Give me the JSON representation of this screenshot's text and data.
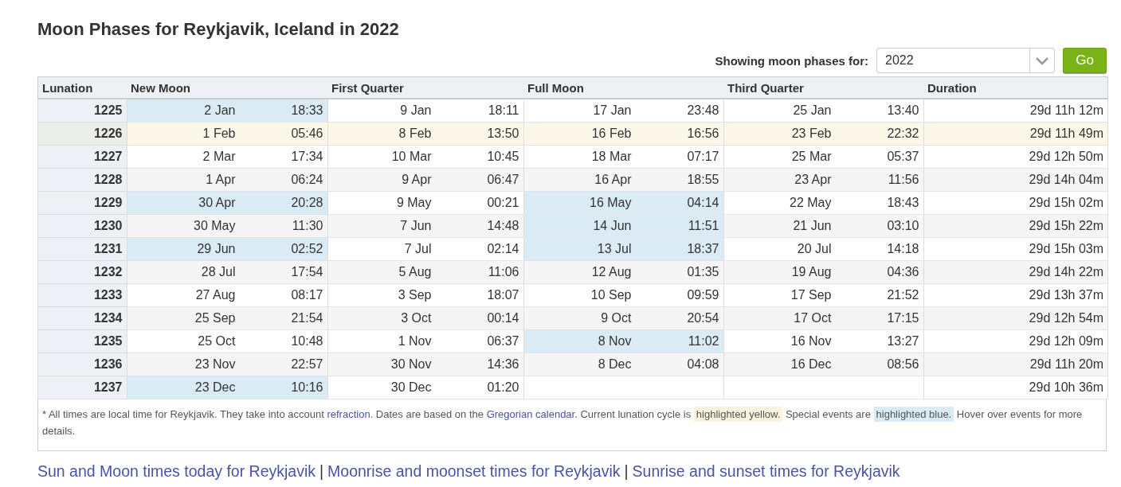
{
  "title": "Moon Phases for Reykjavik, Iceland in 2022",
  "selector": {
    "label": "Showing moon phases for:",
    "value": "2022",
    "button": "Go"
  },
  "columns": [
    "Lunation",
    "New Moon",
    "First Quarter",
    "Full Moon",
    "Third Quarter",
    "Duration"
  ],
  "rows": [
    {
      "lunation": "1225",
      "current": false,
      "phases": [
        {
          "date": "2 Jan",
          "time": "18:33",
          "special": true
        },
        {
          "date": "9 Jan",
          "time": "18:11",
          "special": false
        },
        {
          "date": "17 Jan",
          "time": "23:48",
          "special": false
        },
        {
          "date": "25 Jan",
          "time": "13:40",
          "special": false
        }
      ],
      "duration": "29d 11h 12m"
    },
    {
      "lunation": "1226",
      "current": true,
      "phases": [
        {
          "date": "1 Feb",
          "time": "05:46",
          "special": false
        },
        {
          "date": "8 Feb",
          "time": "13:50",
          "special": false
        },
        {
          "date": "16 Feb",
          "time": "16:56",
          "special": false
        },
        {
          "date": "23 Feb",
          "time": "22:32",
          "special": false
        }
      ],
      "duration": "29d 11h 49m"
    },
    {
      "lunation": "1227",
      "current": false,
      "phases": [
        {
          "date": "2 Mar",
          "time": "17:34",
          "special": false
        },
        {
          "date": "10 Mar",
          "time": "10:45",
          "special": false
        },
        {
          "date": "18 Mar",
          "time": "07:17",
          "special": false
        },
        {
          "date": "25 Mar",
          "time": "05:37",
          "special": false
        }
      ],
      "duration": "29d 12h 50m"
    },
    {
      "lunation": "1228",
      "current": false,
      "phases": [
        {
          "date": "1 Apr",
          "time": "06:24",
          "special": false
        },
        {
          "date": "9 Apr",
          "time": "06:47",
          "special": false
        },
        {
          "date": "16 Apr",
          "time": "18:55",
          "special": false
        },
        {
          "date": "23 Apr",
          "time": "11:56",
          "special": false
        }
      ],
      "duration": "29d 14h 04m"
    },
    {
      "lunation": "1229",
      "current": false,
      "phases": [
        {
          "date": "30 Apr",
          "time": "20:28",
          "special": true
        },
        {
          "date": "9 May",
          "time": "00:21",
          "special": false
        },
        {
          "date": "16 May",
          "time": "04:14",
          "special": true
        },
        {
          "date": "22 May",
          "time": "18:43",
          "special": false
        }
      ],
      "duration": "29d 15h 02m"
    },
    {
      "lunation": "1230",
      "current": false,
      "phases": [
        {
          "date": "30 May",
          "time": "11:30",
          "special": false
        },
        {
          "date": "7 Jun",
          "time": "14:48",
          "special": false
        },
        {
          "date": "14 Jun",
          "time": "11:51",
          "special": true
        },
        {
          "date": "21 Jun",
          "time": "03:10",
          "special": false
        }
      ],
      "duration": "29d 15h 22m"
    },
    {
      "lunation": "1231",
      "current": false,
      "phases": [
        {
          "date": "29 Jun",
          "time": "02:52",
          "special": true
        },
        {
          "date": "7 Jul",
          "time": "02:14",
          "special": false
        },
        {
          "date": "13 Jul",
          "time": "18:37",
          "special": true
        },
        {
          "date": "20 Jul",
          "time": "14:18",
          "special": false
        }
      ],
      "duration": "29d 15h 03m"
    },
    {
      "lunation": "1232",
      "current": false,
      "phases": [
        {
          "date": "28 Jul",
          "time": "17:54",
          "special": false
        },
        {
          "date": "5 Aug",
          "time": "11:06",
          "special": false
        },
        {
          "date": "12 Aug",
          "time": "01:35",
          "special": false
        },
        {
          "date": "19 Aug",
          "time": "04:36",
          "special": false
        }
      ],
      "duration": "29d 14h 22m"
    },
    {
      "lunation": "1233",
      "current": false,
      "phases": [
        {
          "date": "27 Aug",
          "time": "08:17",
          "special": false
        },
        {
          "date": "3 Sep",
          "time": "18:07",
          "special": false
        },
        {
          "date": "10 Sep",
          "time": "09:59",
          "special": false
        },
        {
          "date": "17 Sep",
          "time": "21:52",
          "special": false
        }
      ],
      "duration": "29d 13h 37m"
    },
    {
      "lunation": "1234",
      "current": false,
      "phases": [
        {
          "date": "25 Sep",
          "time": "21:54",
          "special": false
        },
        {
          "date": "3 Oct",
          "time": "00:14",
          "special": false
        },
        {
          "date": "9 Oct",
          "time": "20:54",
          "special": false
        },
        {
          "date": "17 Oct",
          "time": "17:15",
          "special": false
        }
      ],
      "duration": "29d 12h 54m"
    },
    {
      "lunation": "1235",
      "current": false,
      "phases": [
        {
          "date": "25 Oct",
          "time": "10:48",
          "special": false
        },
        {
          "date": "1 Nov",
          "time": "06:37",
          "special": false
        },
        {
          "date": "8 Nov",
          "time": "11:02",
          "special": true
        },
        {
          "date": "16 Nov",
          "time": "13:27",
          "special": false
        }
      ],
      "duration": "29d 12h 09m"
    },
    {
      "lunation": "1236",
      "current": false,
      "phases": [
        {
          "date": "23 Nov",
          "time": "22:57",
          "special": false
        },
        {
          "date": "30 Nov",
          "time": "14:36",
          "special": false
        },
        {
          "date": "8 Dec",
          "time": "04:08",
          "special": false
        },
        {
          "date": "16 Dec",
          "time": "08:56",
          "special": false
        }
      ],
      "duration": "29d 11h 20m"
    },
    {
      "lunation": "1237",
      "current": false,
      "phases": [
        {
          "date": "23 Dec",
          "time": "10:16",
          "special": true
        },
        {
          "date": "30 Dec",
          "time": "01:20",
          "special": false
        }
      ],
      "duration": "29d 10h 36m"
    }
  ],
  "footnote": [
    {
      "kind": "text",
      "text": "* All times are local time for Reykjavik. They take into account"
    },
    {
      "kind": "link",
      "text": "refraction"
    },
    {
      "kind": "text",
      "text": ". Dates are based on the"
    },
    {
      "kind": "link",
      "text": "Gregorian calendar"
    },
    {
      "kind": "text",
      "text": ". Current lunation cycle is"
    },
    {
      "kind": "yellow",
      "text": "highlighted yellow."
    },
    {
      "kind": "text",
      "text": "Special events are"
    },
    {
      "kind": "blue",
      "text": "highlighted blue."
    },
    {
      "kind": "text",
      "text": "Hover over events for more details."
    }
  ],
  "links": [
    {
      "kind": "link",
      "text": "Sun and Moon times today for Reykjavik"
    },
    {
      "kind": "separator",
      "text": "|"
    },
    {
      "kind": "link",
      "text": "Moonrise and moonset times for Reykjavik"
    },
    {
      "kind": "separator",
      "text": "|"
    },
    {
      "kind": "link",
      "text": "Sunrise and sunset times for Reykjavik"
    }
  ]
}
